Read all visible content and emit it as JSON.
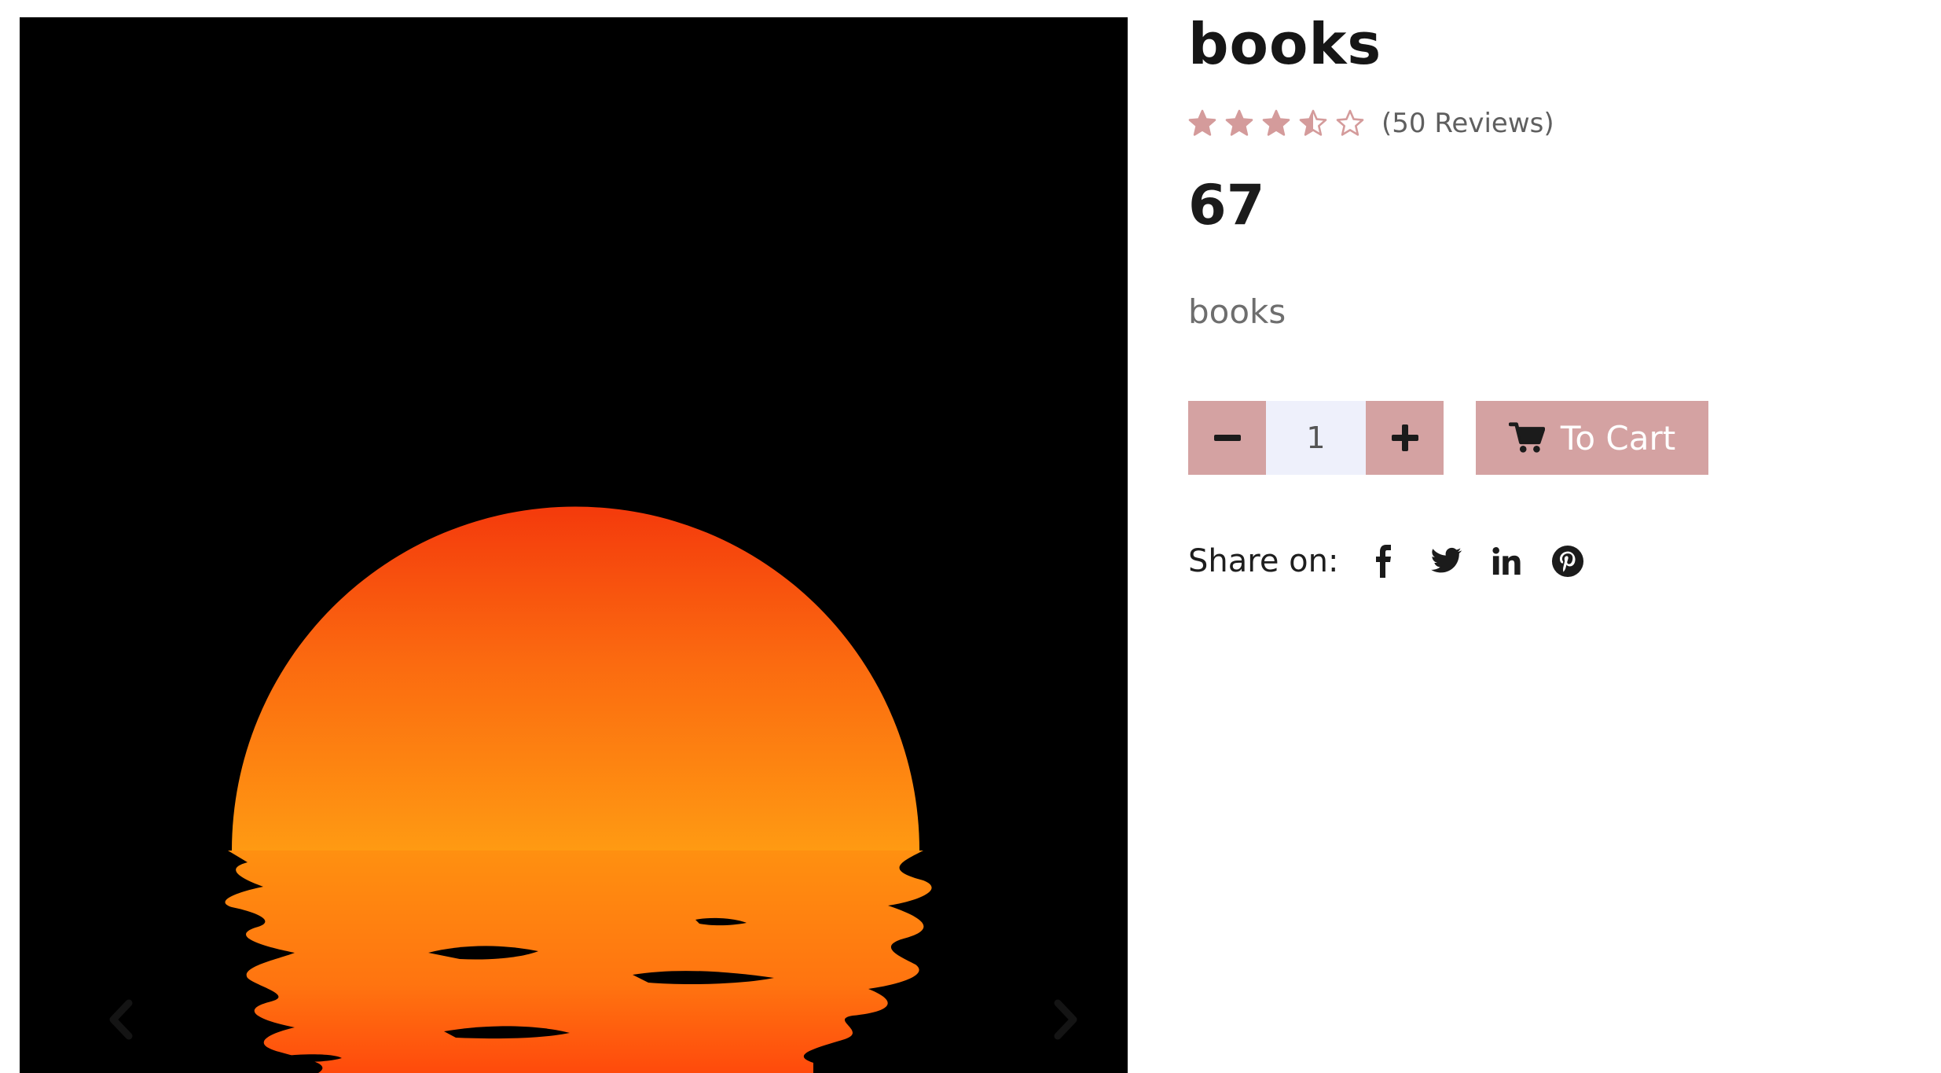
{
  "gallery": {
    "image_icon": "sunset-over-water-image",
    "prev_icon": "chevron-left-icon",
    "next_icon": "chevron-right-icon"
  },
  "product": {
    "title": "books",
    "rating": 3.5,
    "rating_max": 5,
    "reviews_label": "(50 Reviews)",
    "price": "67",
    "description": "books"
  },
  "cart": {
    "minus_icon": "minus-icon",
    "quantity": "1",
    "plus_icon": "plus-icon",
    "cart_icon": "cart-icon",
    "add_label": "To Cart"
  },
  "share": {
    "label": "Share on:",
    "icons": [
      "facebook-icon",
      "twitter-icon",
      "linkedin-icon",
      "pinterest-icon"
    ]
  },
  "colors": {
    "accent": "#d4a2a2",
    "star": "#d49b9b",
    "quantity_bg": "#eef0fb",
    "text_dark": "#1b1b1b",
    "text_muted": "#6e6e6e"
  }
}
